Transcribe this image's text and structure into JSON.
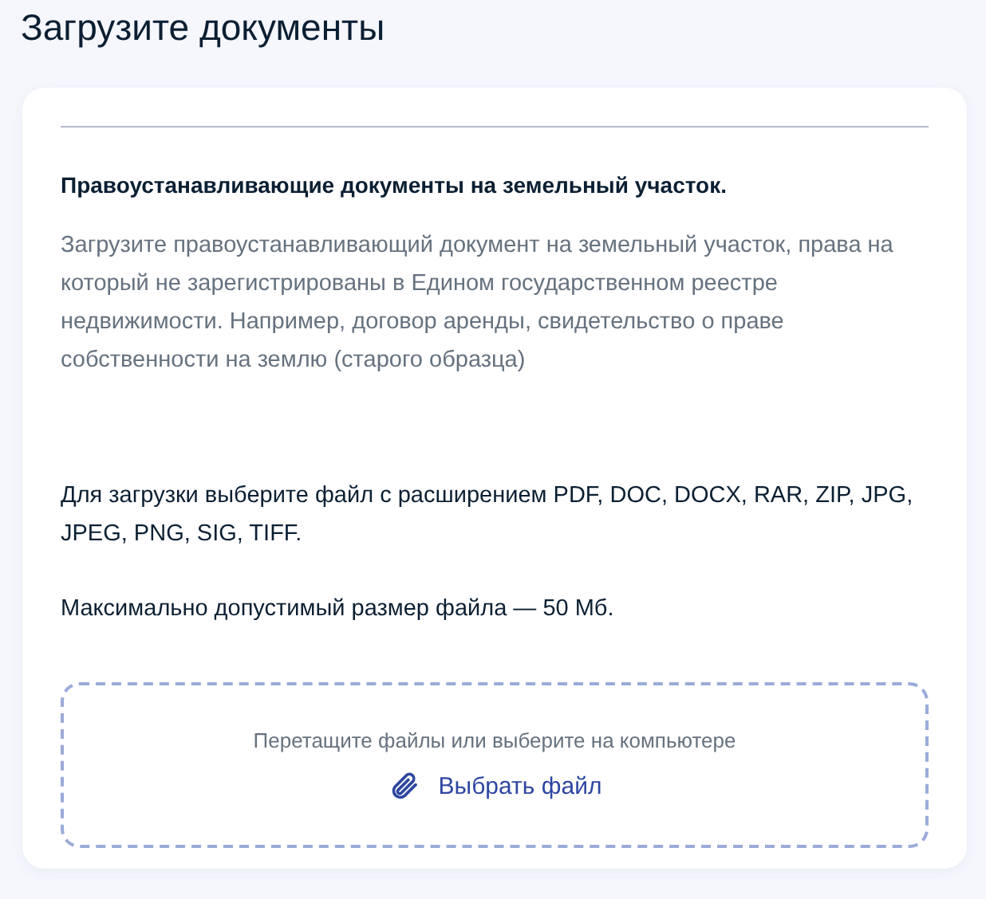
{
  "page_title": "Загрузите документы",
  "section": {
    "heading": "Правоустанавливающие документы на земельный участок.",
    "description": "Загрузите правоустанавливающий документ на земельный участок, права на который не зарегистрированы в Едином государственном реестре недвижимости. Например, договор аренды, свидетельство о праве собственности на землю (старого образца)",
    "notes": [
      "Для загрузки выберите файл с расширением PDF, DOC, DOCX, RAR, ZIP, JPG, JPEG, PNG, SIG, TIFF.",
      "Максимально допустимый размер файла — 50 Мб."
    ]
  },
  "dropzone": {
    "hint": "Перетащите файлы или выберите на компьютере",
    "button": "Выбрать файл"
  }
}
